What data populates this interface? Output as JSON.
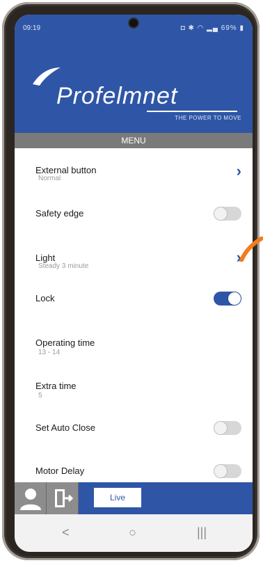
{
  "status_bar": {
    "time": "09:19",
    "battery": "69%"
  },
  "header": {
    "brand": "Profelmnet",
    "tagline": "THE POWER TO MOVE"
  },
  "menu": {
    "title": "MENU",
    "items": [
      {
        "label": "External button",
        "sub": "Normal",
        "control": "chevron"
      },
      {
        "label": "Safety edge",
        "sub": "",
        "control": "toggle",
        "on": false
      },
      {
        "label": "Light",
        "sub": "Steady 3 minute",
        "control": "chevron"
      },
      {
        "label": "Lock",
        "sub": "",
        "control": "toggle",
        "on": true
      },
      {
        "label": "Operating time",
        "sub": "13 - 14",
        "control": "none"
      },
      {
        "label": "Extra time",
        "sub": "5",
        "control": "none"
      },
      {
        "label": "Set Auto Close",
        "sub": "",
        "control": "toggle",
        "on": false
      },
      {
        "label": "Motor Delay",
        "sub": "",
        "control": "toggle",
        "on": false
      }
    ]
  },
  "bottom_bar": {
    "live_label": "Live",
    "icons": [
      "user-icon",
      "exit-door-icon"
    ]
  },
  "colors": {
    "brand_blue": "#2f56a6",
    "menu_gray": "#7a7a7a",
    "toggle_off": "#d7d7d7",
    "accent_orange": "#f07d1e"
  }
}
